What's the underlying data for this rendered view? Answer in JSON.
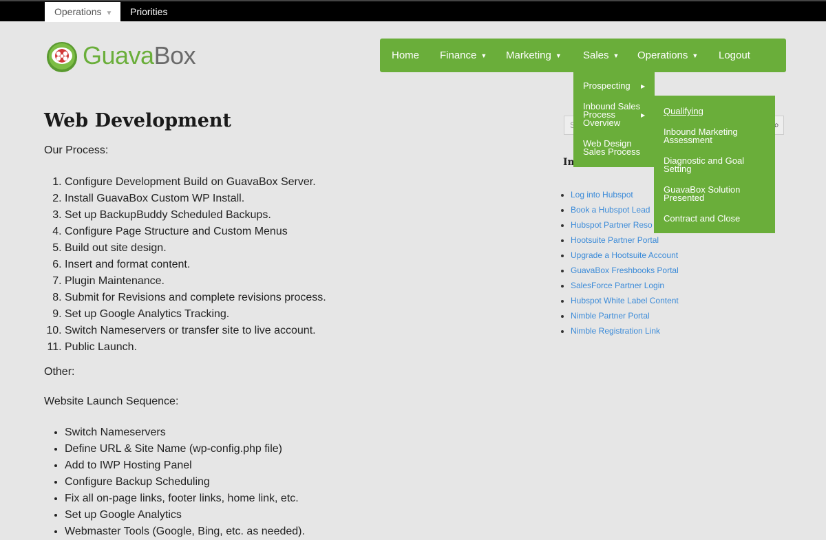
{
  "topbar": {
    "active_tab": "Operations",
    "tab2": "Priorities"
  },
  "logo": {
    "part1": "Guava",
    "part2": "Box"
  },
  "nav": {
    "items": [
      {
        "label": "Home",
        "caret": false
      },
      {
        "label": "Finance",
        "caret": true
      },
      {
        "label": "Marketing",
        "caret": true
      },
      {
        "label": "Sales",
        "caret": true
      },
      {
        "label": "Operations",
        "caret": true
      },
      {
        "label": "Logout",
        "caret": false
      }
    ]
  },
  "sales_menu": {
    "items": [
      {
        "l1": "Prospecting",
        "l2": "",
        "l3": ""
      },
      {
        "l1": "Inbound Sales",
        "l2": "Process",
        "l3": "Overview"
      },
      {
        "l1": "Web Design",
        "l2": "Sales Process",
        "l3": ""
      }
    ]
  },
  "submenu": {
    "items": [
      {
        "l1": "Qualifying",
        "l2": ""
      },
      {
        "l1": "Inbound Marketing",
        "l2": "Assessment"
      },
      {
        "l1": "Diagnostic and Goal",
        "l2": "Setting"
      },
      {
        "l1": "GuavaBox Solution",
        "l2": "Presented"
      },
      {
        "l1": "Contract and Close",
        "l2": ""
      }
    ]
  },
  "page": {
    "title": "Web Development",
    "our_process": "Our Process:",
    "steps": [
      "Configure Development Build on GuavaBox Server.",
      "Install GuavaBox Custom WP Install.",
      "Set up BackupBuddy Scheduled Backups.",
      "Configure Page Structure and Custom Menus",
      "Build out site design.",
      "Insert and format content.",
      "Plugin Maintenance.",
      "Submit for Revisions and complete revisions process.",
      "Set up Google Analytics Tracking.",
      "Switch Nameservers or transfer site to live account.",
      "Public Launch."
    ],
    "other": "Other:",
    "launch_heading": "Website Launch Sequence:",
    "launch_items": [
      "Switch Nameservers",
      "Define URL & Site Name (wp-config.php file)",
      "Add to IWP Hosting Panel",
      "Configure Backup Scheduling",
      "Fix all on-page links, footer links, home link, etc.",
      "Set up Google Analytics",
      "Webmaster Tools (Google, Bing, etc. as needed)."
    ]
  },
  "sidebar": {
    "search_placeholder": "S",
    "heading": "Im",
    "links": [
      "Log into Hubspot",
      "Book a Hubspot Lead",
      "Hubspot Partner Reso",
      "Hootsuite Partner Portal",
      "Upgrade a Hootsuite Account",
      "GuavaBox Freshbooks Portal",
      "SalesForce Partner Login",
      "Hubspot White Label Content",
      "Nimble Partner Portal",
      "Nimble Registration Link"
    ]
  },
  "colors": {
    "brand_green": "#6aae3a",
    "link_blue": "#3a8ad8"
  }
}
